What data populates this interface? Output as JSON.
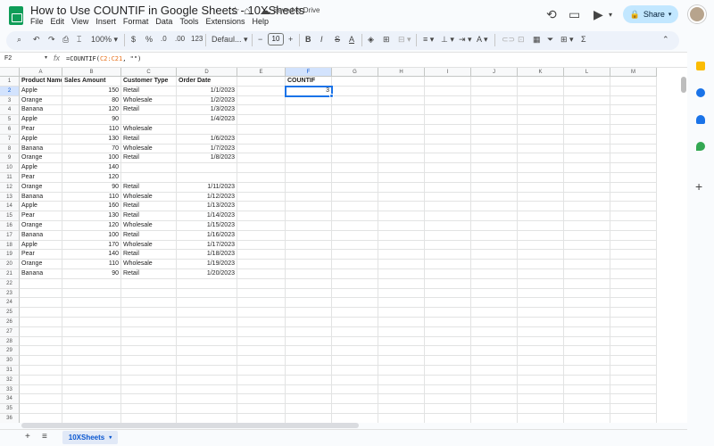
{
  "doc": {
    "title": "How to Use COUNTIF in Google Sheets - 10XSheets",
    "saved": "Saved to Drive"
  },
  "menu": [
    "File",
    "Edit",
    "View",
    "Insert",
    "Format",
    "Data",
    "Tools",
    "Extensions",
    "Help"
  ],
  "share_label": "Share",
  "toolbar": {
    "zoom": "100%",
    "currency": "$",
    "percent": "%",
    "dec_decrease": ".0",
    "dec_increase": ".00",
    "format_num": "123",
    "font": "Defaul...",
    "font_size": "10",
    "minus": "−",
    "plus": "+",
    "bold": "B",
    "italic": "I",
    "strike": "S",
    "text_color": "A",
    "sum": "Σ"
  },
  "formula_bar": {
    "cell_ref": "F2",
    "fx": "fx",
    "prefix": "=COUNTIF(",
    "range": "C2:C21",
    "suffix": ", \"\")"
  },
  "columns": [
    "A",
    "B",
    "C",
    "D",
    "E",
    "F",
    "G",
    "H",
    "I",
    "J",
    "K",
    "L",
    "M"
  ],
  "row_numbers": [
    "1",
    "2",
    "3",
    "4",
    "5",
    "6",
    "7",
    "8",
    "9",
    "10",
    "11",
    "12",
    "13",
    "14",
    "15",
    "16",
    "17",
    "18",
    "19",
    "20",
    "21",
    "22",
    "23",
    "24",
    "25",
    "26",
    "27",
    "28",
    "29",
    "30",
    "31",
    "32",
    "33",
    "34",
    "35",
    "36"
  ],
  "headers": {
    "a": "Product Name",
    "b": "Sales Amount",
    "c": "Customer Type",
    "d": "Order Date",
    "f": "COUNTIF"
  },
  "rows": [
    [
      "Apple",
      "150",
      "Retail",
      "1/1/2023"
    ],
    [
      "Orange",
      "80",
      "Wholesale",
      "1/2/2023"
    ],
    [
      "Banana",
      "120",
      "Retail",
      "1/3/2023"
    ],
    [
      "Apple",
      "90",
      "",
      "1/4/2023"
    ],
    [
      "Pear",
      "110",
      "Wholesale",
      ""
    ],
    [
      "Apple",
      "130",
      "Retail",
      "1/6/2023"
    ],
    [
      "Banana",
      "70",
      "Wholesale",
      "1/7/2023"
    ],
    [
      "Orange",
      "100",
      "Retail",
      "1/8/2023"
    ],
    [
      "Apple",
      "140",
      "",
      ""
    ],
    [
      "Pear",
      "120",
      "",
      ""
    ],
    [
      "Orange",
      "90",
      "Retail",
      "1/11/2023"
    ],
    [
      "Banana",
      "110",
      "Wholesale",
      "1/12/2023"
    ],
    [
      "Apple",
      "160",
      "Retail",
      "1/13/2023"
    ],
    [
      "Pear",
      "130",
      "Retail",
      "1/14/2023"
    ],
    [
      "Orange",
      "120",
      "Wholesale",
      "1/15/2023"
    ],
    [
      "Banana",
      "100",
      "Retail",
      "1/16/2023"
    ],
    [
      "Apple",
      "170",
      "Wholesale",
      "1/17/2023"
    ],
    [
      "Pear",
      "140",
      "Retail",
      "1/18/2023"
    ],
    [
      "Orange",
      "110",
      "Wholesale",
      "1/19/2023"
    ],
    [
      "Banana",
      "90",
      "Retail",
      "1/20/2023"
    ]
  ],
  "result": "3",
  "sheet_tab": "10XSheets",
  "bottom": {
    "add": "+",
    "list": "≡"
  }
}
